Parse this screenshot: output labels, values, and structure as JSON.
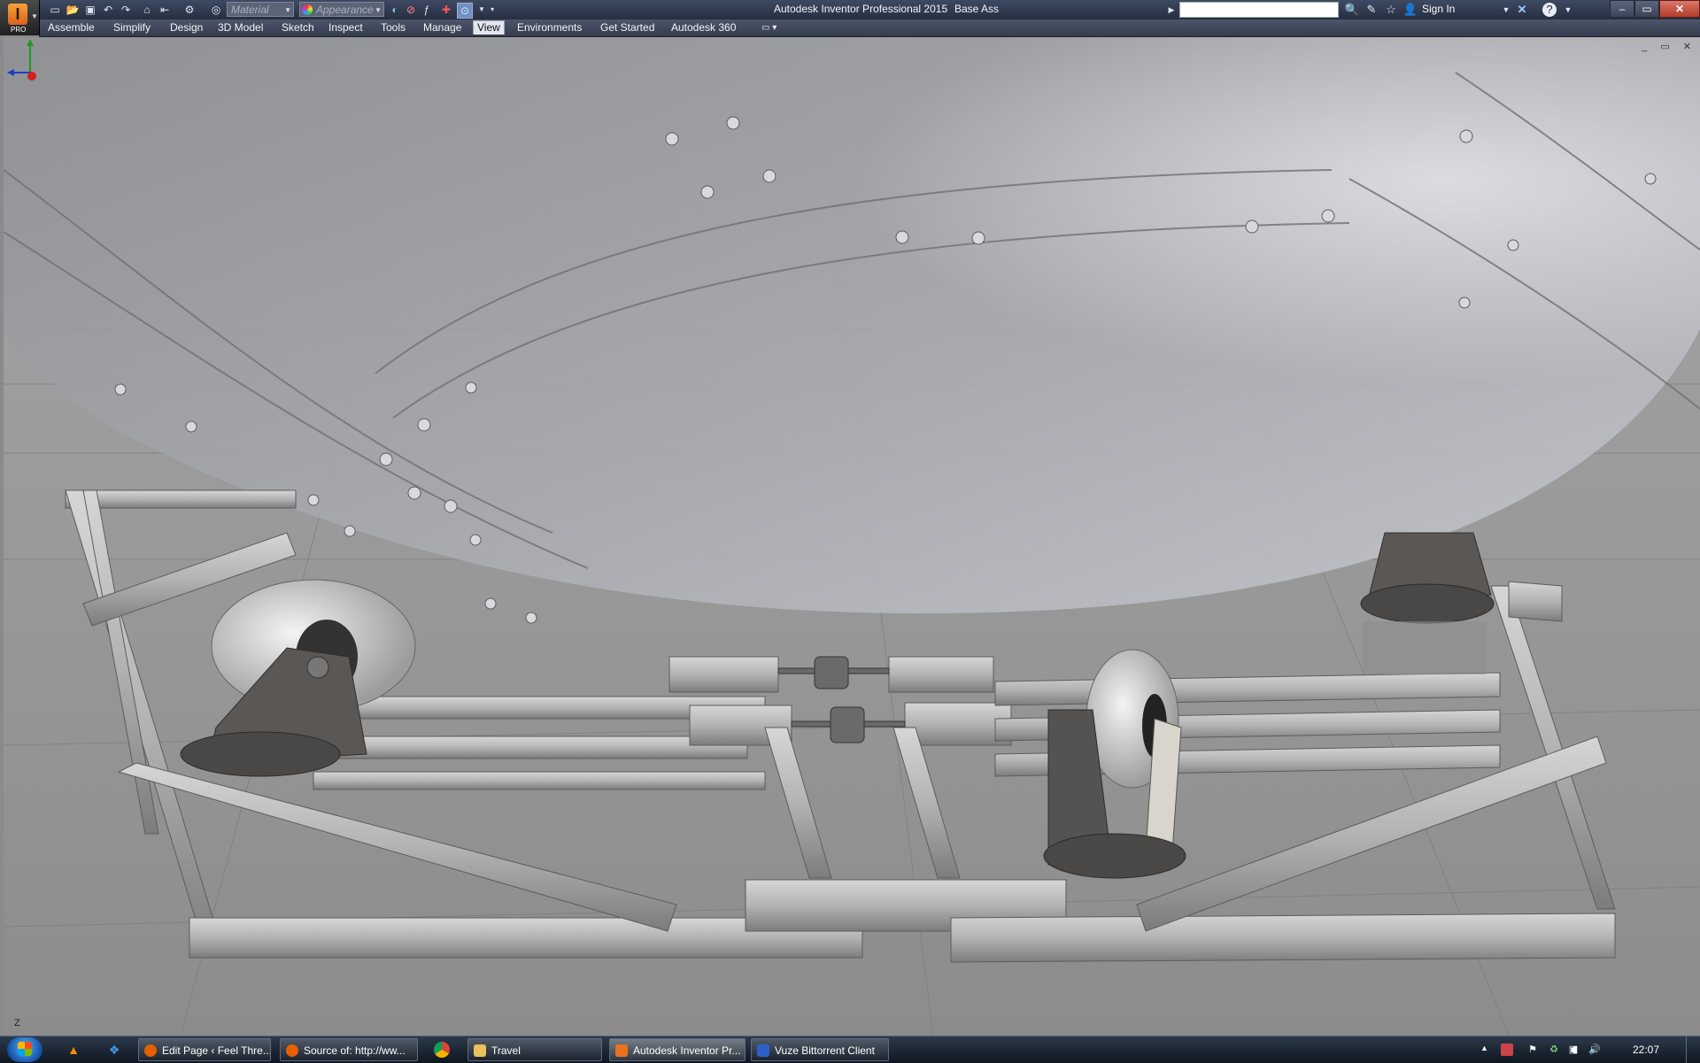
{
  "titlebar": {
    "app_name": "Autodesk Inventor Professional 2015",
    "document": "Base Ass",
    "material_placeholder": "Material",
    "appearance_placeholder": "Appearance",
    "search_value": "",
    "sign_in": "Sign In",
    "app_badge": "PRO",
    "app_letter": "I"
  },
  "ribbon": {
    "tabs": [
      {
        "label": "Assemble"
      },
      {
        "label": "Simplify"
      },
      {
        "label": "Design"
      },
      {
        "label": "3D Model"
      },
      {
        "label": "Sketch"
      },
      {
        "label": "Inspect"
      },
      {
        "label": "Tools"
      },
      {
        "label": "Manage"
      },
      {
        "label": "View",
        "active": true
      },
      {
        "label": "Environments"
      },
      {
        "label": "Get Started"
      },
      {
        "label": "Autodesk 360"
      }
    ]
  },
  "viewport": {
    "triad_axis_label": "Z"
  },
  "taskbar": {
    "buttons": [
      {
        "label": "Edit Page ‹ Feel Thre...",
        "icon": "firefox-icon",
        "color": "#e66000"
      },
      {
        "label": "Source of: http://ww...",
        "icon": "firefox-icon",
        "color": "#e66000"
      },
      {
        "label": "Travel",
        "icon": "folder-icon",
        "color": "#e8c25a"
      },
      {
        "label": "Autodesk Inventor Pr...",
        "icon": "inventor-icon",
        "color": "#e8731f",
        "active": true
      },
      {
        "label": "Vuze Bittorrent Client",
        "icon": "vuze-icon",
        "color": "#2a62c9"
      }
    ],
    "clock": "22:07"
  }
}
